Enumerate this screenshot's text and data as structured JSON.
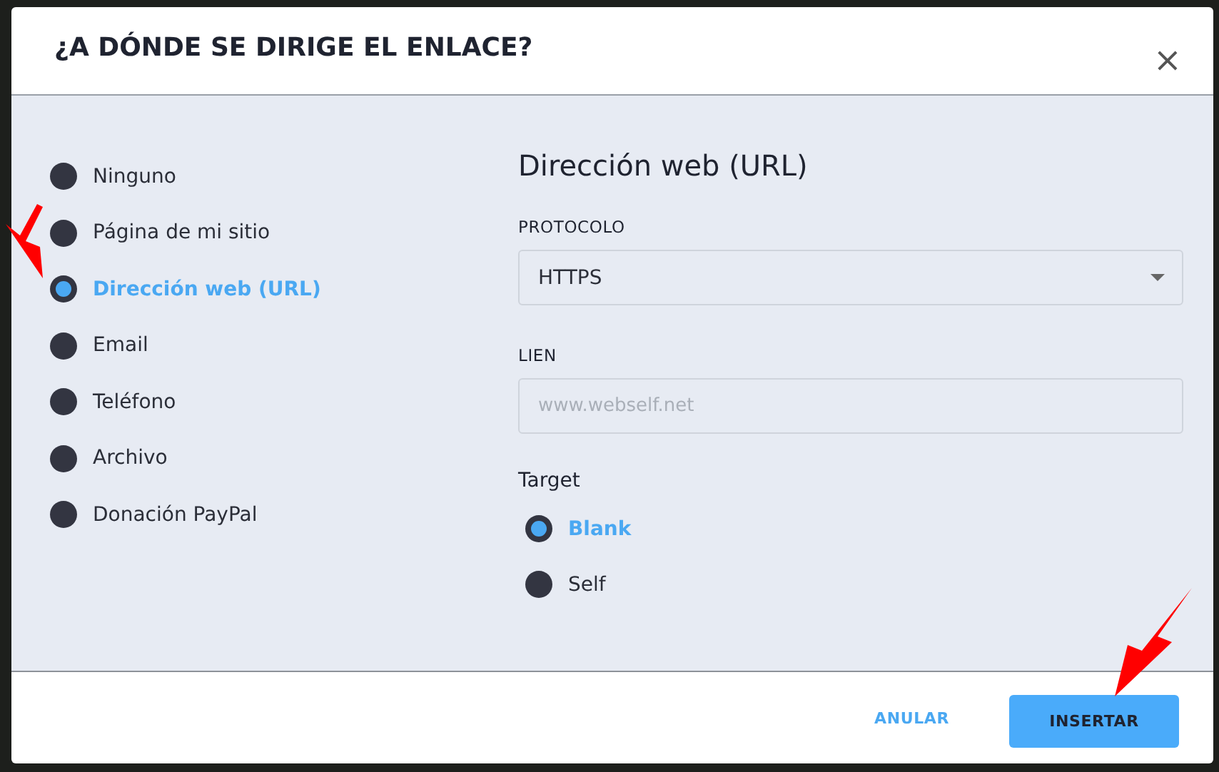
{
  "dialog": {
    "title": "¿A DÓNDE SE DIRIGE EL ENLACE?",
    "close": "×"
  },
  "link_types": [
    {
      "label": "Ninguno",
      "selected": false
    },
    {
      "label": "Página de mi sitio",
      "selected": false
    },
    {
      "label": "Dirección web (URL)",
      "selected": true
    },
    {
      "label": "Email",
      "selected": false
    },
    {
      "label": "Teléfono",
      "selected": false
    },
    {
      "label": "Archivo",
      "selected": false
    },
    {
      "label": "Donación PayPal",
      "selected": false
    }
  ],
  "panel": {
    "heading": "Dirección web (URL)",
    "protocol": {
      "label": "PROTOCOLO",
      "value": "HTTPS"
    },
    "link": {
      "label": "LIEN",
      "placeholder": "www.webself.net"
    },
    "target": {
      "label": "Target",
      "options": [
        {
          "label": "Blank",
          "selected": true
        },
        {
          "label": "Self",
          "selected": false
        }
      ]
    }
  },
  "buttons": [
    {
      "label": "ANULAR",
      "kind": "text"
    },
    {
      "label": "INSERTAR",
      "kind": "primary"
    }
  ]
}
